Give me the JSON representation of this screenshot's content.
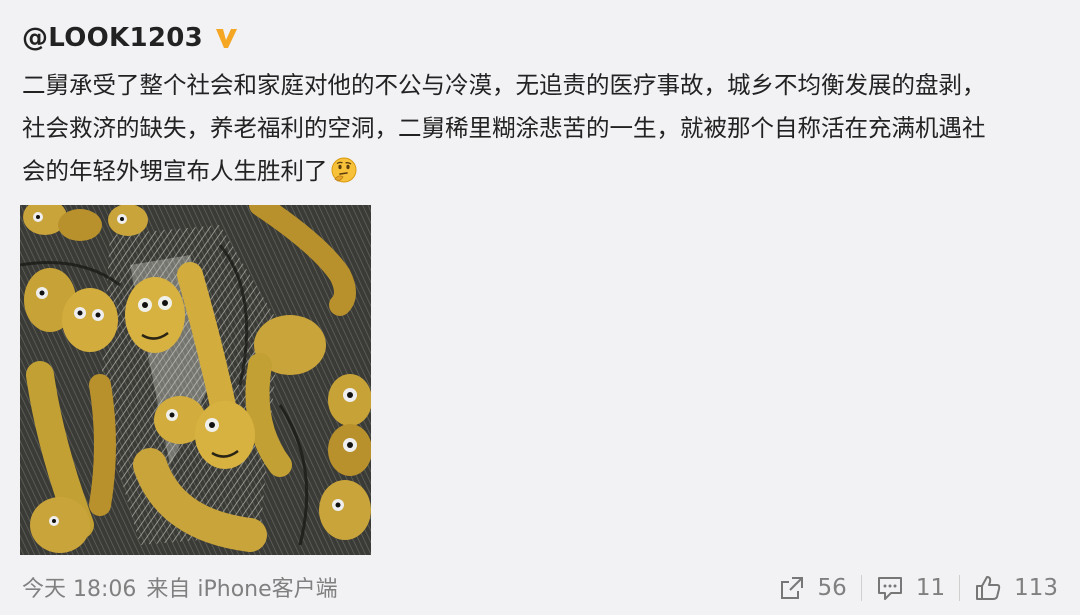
{
  "post": {
    "username": "@LOOK1203",
    "verified_badge_icon": "verified-v-icon",
    "text_lines": [
      "二舅承受了整个社会和家庭对他的不公与冷漠，无追责的医疗事故，城乡不均衡发展的盘剥，",
      "社会救济的缺失，养老福利的空洞，二舅稀里糊涂悲苦的一生，就被那个自称活在充满机遇社",
      "会的年轻外甥宣布人生胜利了"
    ],
    "emoji_icon": "thinking-face-icon"
  },
  "footer": {
    "time": "今天 18:06",
    "source": "来自 iPhone客户端",
    "share_count": "56",
    "comment_count": "11",
    "like_count": "113"
  },
  "colors": {
    "background": "#f2f2f5",
    "text": "#222222",
    "meta": "#808080",
    "verified": "#f5a623"
  }
}
